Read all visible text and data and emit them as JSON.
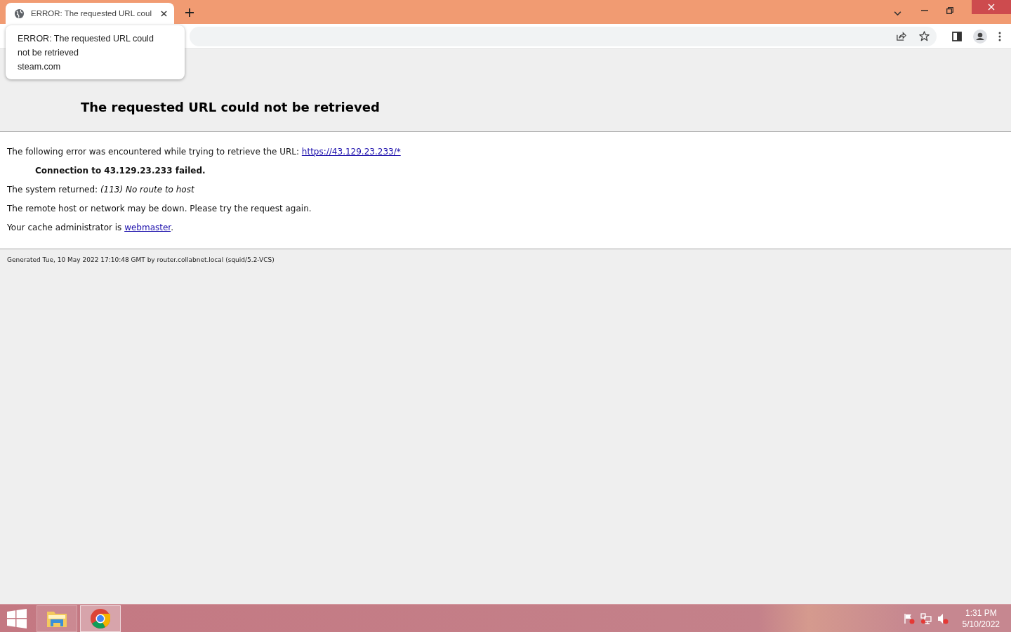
{
  "browser": {
    "tabs": [
      {
        "title": "ERROR: The requested URL coul",
        "selected": true
      }
    ],
    "tooltip": {
      "title": "ERROR: The requested URL could not be retrieved",
      "domain": "steam.com"
    }
  },
  "page": {
    "subheading": "The requested URL could not be retrieved",
    "intro": "The following error was encountered while trying to retrieve the URL: ",
    "url": "https://43.129.23.233/*",
    "failure": "Connection to 43.129.23.233 failed.",
    "returned_label": "The system returned: ",
    "returned_value": "(113) No route to host",
    "advice": "The remote host or network may be down. Please try the request again.",
    "admin_label": "Your cache administrator is ",
    "admin_link": "webmaster",
    "admin_end": ".",
    "footer": "Generated Tue, 10 May 2022 17:10:48 GMT by router.collabnet.local (squid/5.2-VCS)"
  },
  "taskbar": {
    "apps": [
      {
        "kind": "folder",
        "selected": false
      },
      {
        "kind": "chrome",
        "selected": true
      }
    ],
    "time": "1:31 PM",
    "date": "5/10/2022"
  }
}
